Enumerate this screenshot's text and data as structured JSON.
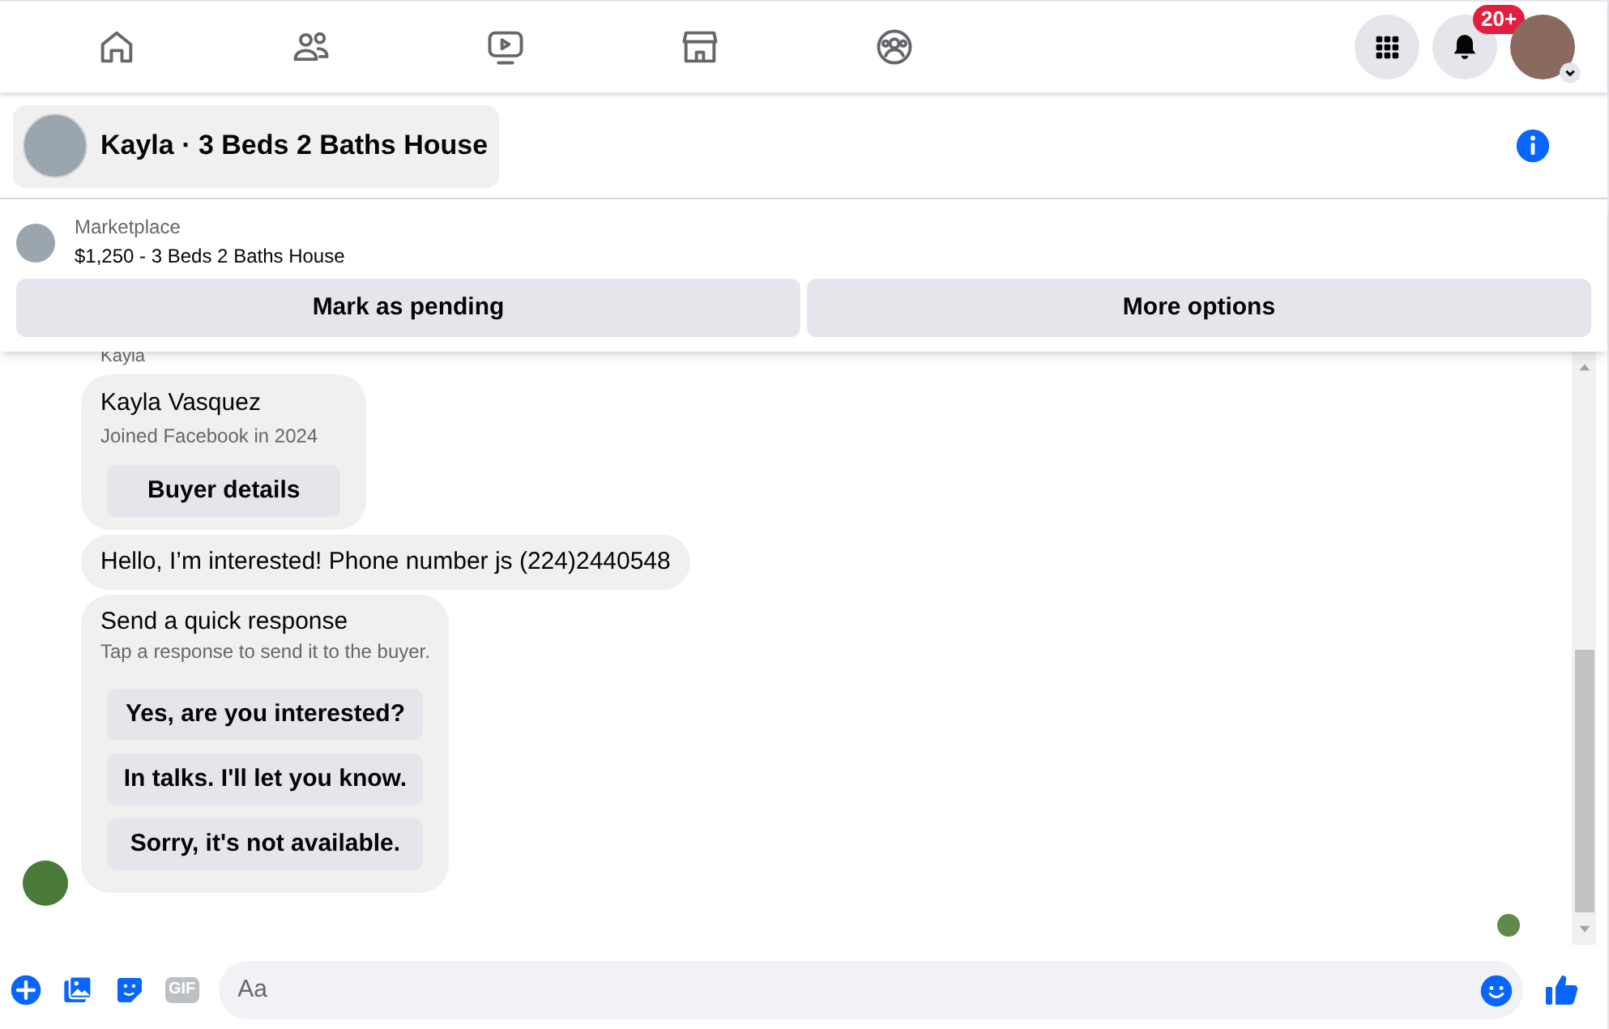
{
  "top_nav": {
    "notification_badge": "20+"
  },
  "chat_header": {
    "title": "Kayla · 3 Beds 2 Baths House"
  },
  "listing": {
    "source": "Marketplace",
    "title": "$1,250 - 3 Beds 2 Baths House",
    "buttons": [
      "Mark as pending",
      "More options"
    ]
  },
  "messages": {
    "sender_label": "Kayla",
    "profile_card": {
      "name": "Kayla Vasquez",
      "joined": "Joined Facebook in 2024",
      "button": "Buyer details"
    },
    "text": "Hello, I’m interested! Phone number js (224)2440548",
    "quick_response": {
      "title": "Send a quick response",
      "subtitle": "Tap a response to send it to the buyer.",
      "options": [
        "Yes, are you interested?",
        "In talks. I'll let you know.",
        "Sorry, it's not available."
      ]
    }
  },
  "composer": {
    "gif_label": "GIF",
    "placeholder": "Aa"
  }
}
